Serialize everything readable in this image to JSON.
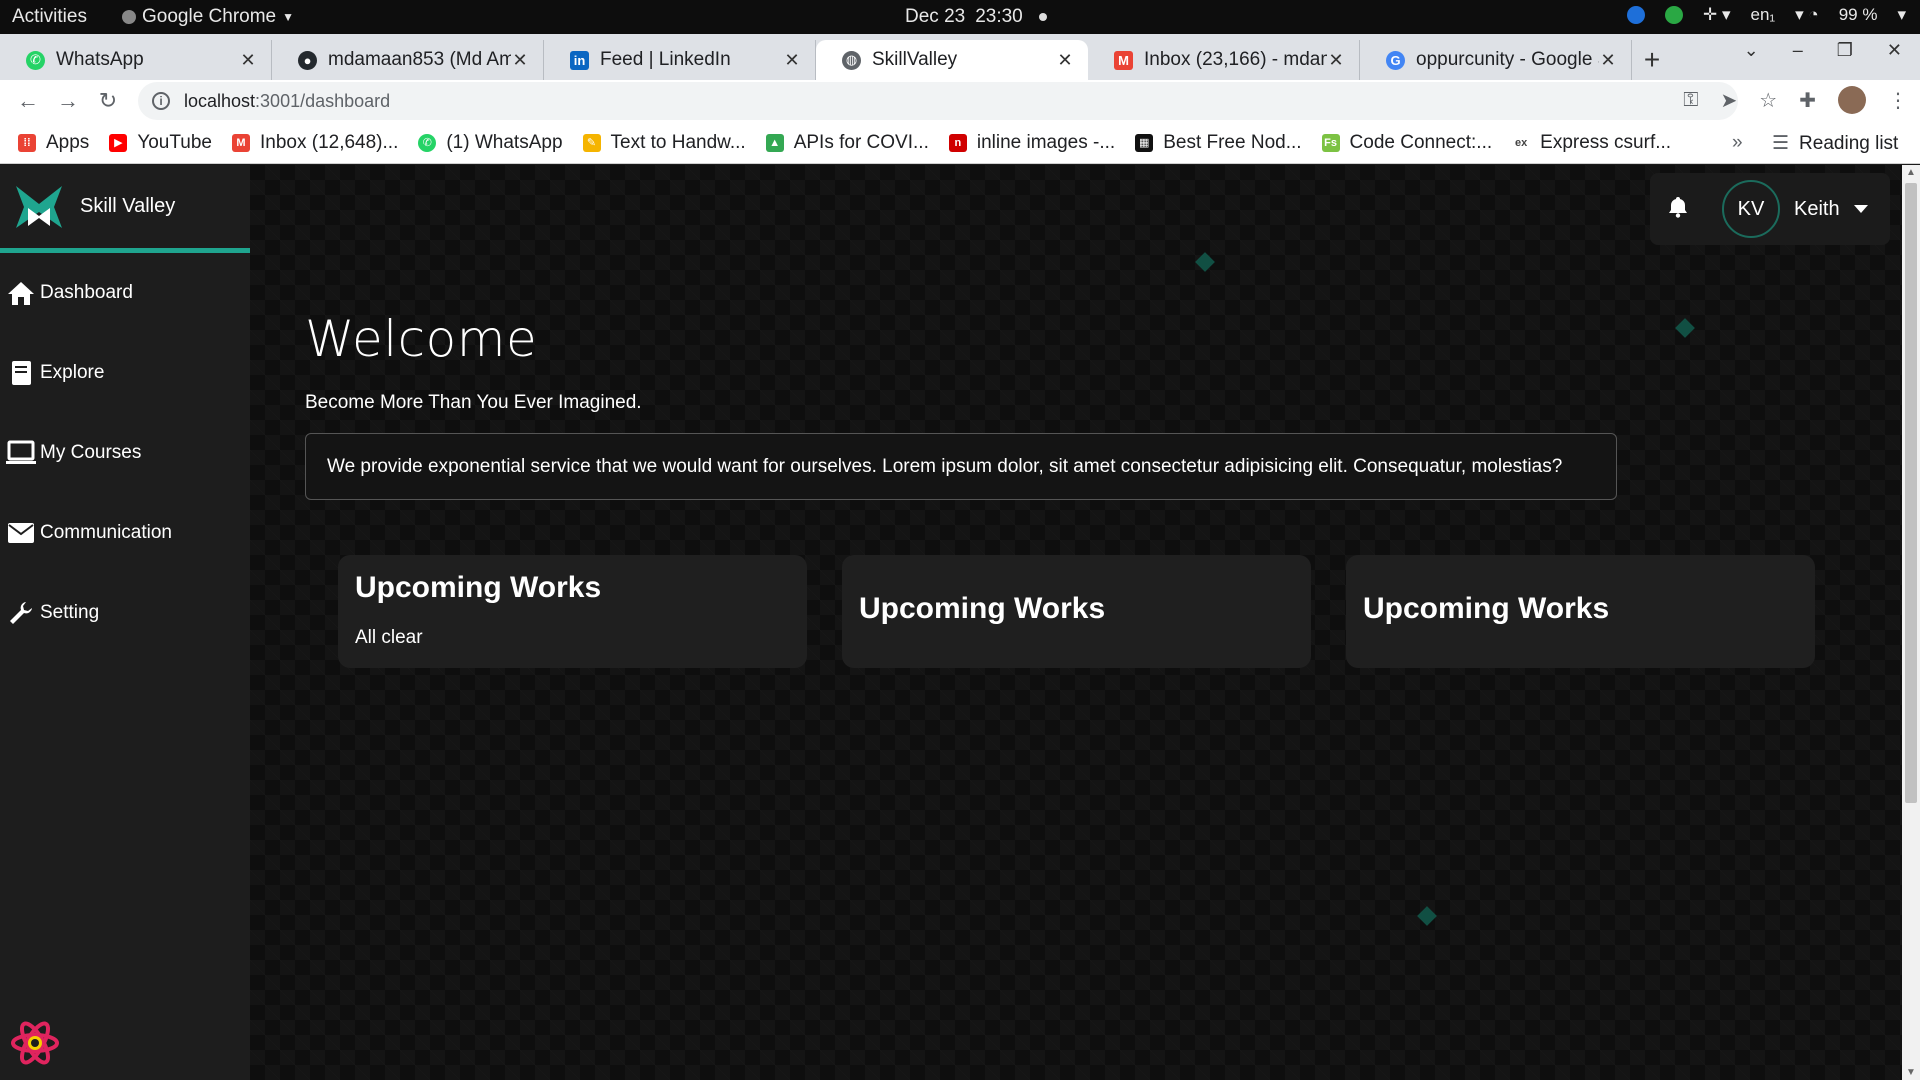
{
  "os_bar": {
    "activities": "Activities",
    "app_name": "Google Chrome",
    "date": "Dec 23",
    "time": "23:30",
    "lang": "en₁",
    "battery": "99 %"
  },
  "tabs": [
    {
      "title": "WhatsApp",
      "icon": "whatsapp-icon",
      "color": "#25d366"
    },
    {
      "title": "mdamaan853 (Md Ama",
      "icon": "github-icon",
      "color": "#24292e"
    },
    {
      "title": "Feed | LinkedIn",
      "icon": "linkedin-icon",
      "color": "#0a66c2"
    },
    {
      "title": "SkillValley",
      "icon": "globe-icon",
      "color": "#5f6368",
      "active": true
    },
    {
      "title": "Inbox (23,166) - mdam",
      "icon": "gmail-icon",
      "color": "#ea4335"
    },
    {
      "title": "oppurcunity - Google S",
      "icon": "google-icon",
      "color": "#4285f4"
    }
  ],
  "address": {
    "host": "localhost",
    "path": ":3001/dashboard"
  },
  "bookmarks": [
    {
      "label": "Apps",
      "icon": "apps-grid-icon",
      "color": "#ea4335"
    },
    {
      "label": "YouTube",
      "icon": "youtube-icon",
      "color": "#ff0000"
    },
    {
      "label": "Inbox (12,648)...",
      "icon": "gmail-icon",
      "color": "#ea4335"
    },
    {
      "label": "(1) WhatsApp",
      "icon": "whatsapp-icon",
      "color": "#25d366"
    },
    {
      "label": "Text to Handw...",
      "icon": "pen-icon",
      "color": "#f5b400"
    },
    {
      "label": "APIs for COVI...",
      "icon": "api-icon",
      "color": "#34a853"
    },
    {
      "label": "inline images -...",
      "icon": "bookmark-red-icon",
      "color": "#d00000"
    },
    {
      "label": "Best Free Nod...",
      "icon": "qr-icon",
      "color": "#111111"
    },
    {
      "label": "Code Connect:...",
      "icon": "code-icon",
      "color": "#7cc243"
    },
    {
      "label": "Express csurf...",
      "icon": "express-icon",
      "color": "#444444"
    }
  ],
  "bookmarks_more": "»",
  "reading_list": "Reading list",
  "brand": {
    "name": "Skill Valley",
    "accent": "#1fa58f"
  },
  "nav": [
    {
      "label": "Dashboard",
      "icon": "home-icon"
    },
    {
      "label": "Explore",
      "icon": "book-icon"
    },
    {
      "label": "My Courses",
      "icon": "laptop-icon"
    },
    {
      "label": "Communication",
      "icon": "envelope-icon"
    },
    {
      "label": "Setting",
      "icon": "wrench-icon"
    }
  ],
  "user": {
    "initials": "KV",
    "name": "Keith"
  },
  "hero": {
    "title": "Welcome",
    "tagline": "Become More Than You Ever Imagined.",
    "mission": "We provide exponential service that we would want for ourselves. Lorem ipsum dolor, sit amet consectetur adipisicing elit. Consequatur, molestias?"
  },
  "cards": [
    {
      "title": "Upcoming Works",
      "subtitle": "All clear"
    },
    {
      "title": "Upcoming Works",
      "subtitle": ""
    },
    {
      "title": "Upcoming Works",
      "subtitle": ""
    }
  ]
}
